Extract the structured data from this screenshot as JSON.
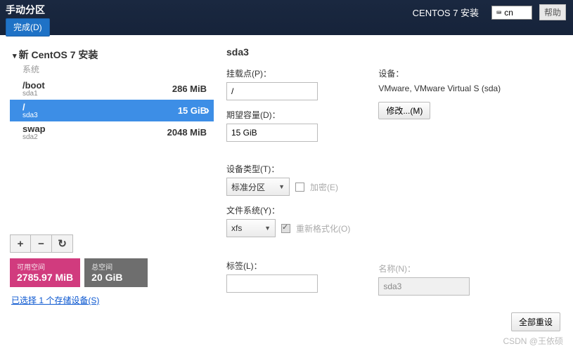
{
  "topbar": {
    "title": "手动分区",
    "done": "完成(D)",
    "right_title": "CENTOS 7 安装",
    "kbd_layout": "cn",
    "help": "帮助"
  },
  "tree": {
    "header": "新 CentOS 7 安装",
    "system": "系统",
    "parts": [
      {
        "name": "/boot",
        "dev": "sda1",
        "size": "286 MiB",
        "selected": false
      },
      {
        "name": "/",
        "dev": "sda3",
        "size": "15 GiB",
        "selected": true
      },
      {
        "name": "swap",
        "dev": "sda2",
        "size": "2048 MiB",
        "selected": false
      }
    ]
  },
  "buttons": {
    "add": "+",
    "remove": "−",
    "reload": "↻"
  },
  "space": {
    "free_label": "可用空间",
    "free_value": "2785.97 MiB",
    "total_label": "总空间",
    "total_value": "20 GiB"
  },
  "storage_link": "已选择 1 个存储设备(S)",
  "right": {
    "title": "sda3",
    "mount_label": "挂载点(P)：",
    "mount_value": "/",
    "desired_label": "期望容量(D)：",
    "desired_value": "15 GiB",
    "devtype_label": "设备类型(T)：",
    "devtype_value": "标准分区",
    "encrypt_label": "加密(E)",
    "fs_label": "文件系统(Y)：",
    "fs_value": "xfs",
    "reformat_label": "重新格式化(O)",
    "label_label": "标签(L)：",
    "label_value": "",
    "device_header": "设备：",
    "device_text": "VMware, VMware Virtual S (sda)",
    "modify": "修改...(M)",
    "name_label": "名称(N)：",
    "name_value": "sda3"
  },
  "footer": {
    "reset": "全部重设",
    "watermark": "CSDN @王依硕"
  }
}
